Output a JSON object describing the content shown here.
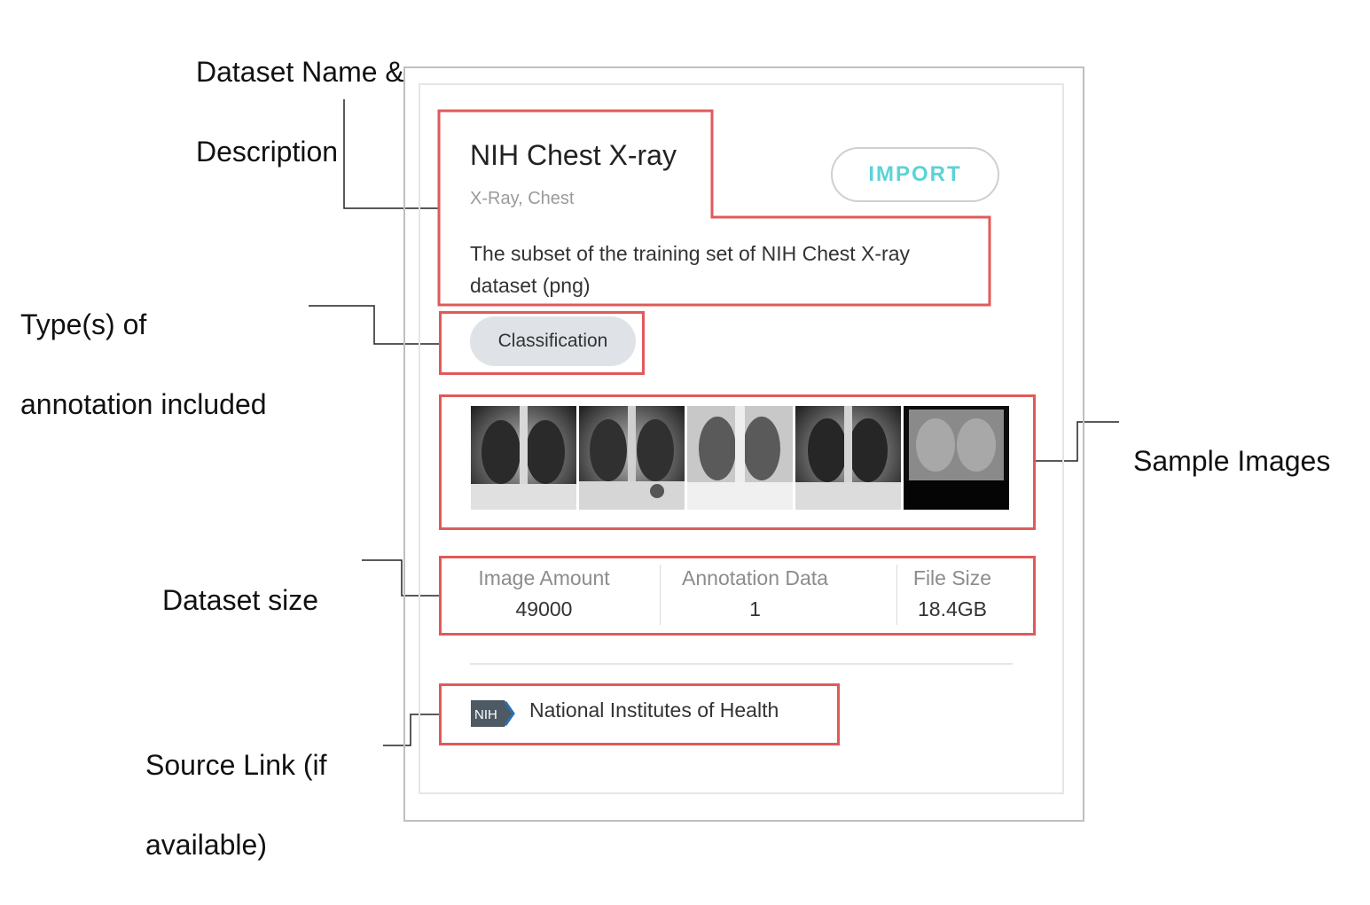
{
  "callouts": {
    "name_desc": [
      "Dataset Name &",
      "Description"
    ],
    "annotation_types": [
      "Type(s) of",
      "annotation included"
    ],
    "sample_images": [
      "Sample Images"
    ],
    "dataset_size": [
      "Dataset size"
    ],
    "source_link": [
      "Source Link (if",
      "available)"
    ]
  },
  "card": {
    "title": "NIH Chest X-ray",
    "tags": "X-Ray, Chest",
    "import_label": "IMPORT",
    "description": "The subset of the training set of NIH Chest X-ray dataset (png)",
    "annotation_chip": "Classification",
    "sample_images": [
      "chest-xray-1",
      "chest-xray-2",
      "chest-xray-3",
      "chest-xray-4",
      "chest-xray-5"
    ],
    "stats": [
      {
        "label": "Image Amount",
        "value": "49000"
      },
      {
        "label": "Annotation Data",
        "value": "1"
      },
      {
        "label": "File Size",
        "value": "18.4GB"
      }
    ],
    "source": {
      "logo_text": "NIH",
      "name": "National Institutes of Health"
    }
  },
  "colors": {
    "highlight": "#e05a5a",
    "import_text": "#5bd3d6",
    "chip_bg": "#dfe3e8"
  }
}
